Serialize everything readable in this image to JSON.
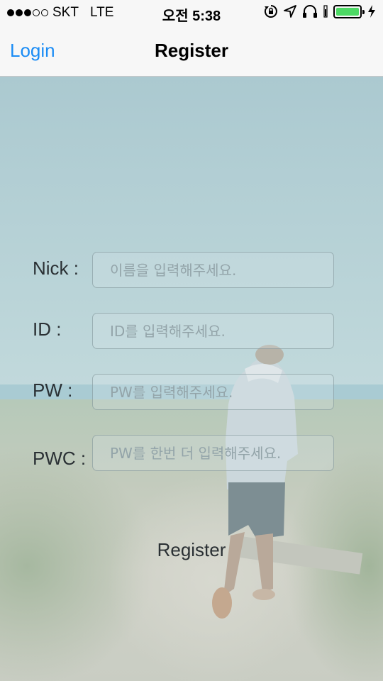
{
  "status_bar": {
    "carrier": "SKT",
    "network": "LTE",
    "time": "오전 5:38",
    "battery_color": "#4cd964"
  },
  "nav": {
    "back_label": "Login",
    "title": "Register",
    "accent_color": "#1a8cf5"
  },
  "form": {
    "fields": [
      {
        "label": "Nick :",
        "placeholder": "이름을 입력해주세요.",
        "value": ""
      },
      {
        "label": "ID :",
        "placeholder": "ID를 입력해주세요.",
        "value": ""
      },
      {
        "label": "PW :",
        "placeholder": "PW를 입력해주세요.",
        "value": ""
      },
      {
        "label": "PWC :",
        "placeholder": "PW를 한번 더 입력해주세요.",
        "value": ""
      }
    ],
    "submit_label": "Register"
  },
  "icons": {
    "status": [
      "signal-dots-icon",
      "rotation-lock-icon",
      "location-arrow-icon",
      "headphones-icon",
      "battery-icon",
      "charging-bolt-icon"
    ]
  }
}
